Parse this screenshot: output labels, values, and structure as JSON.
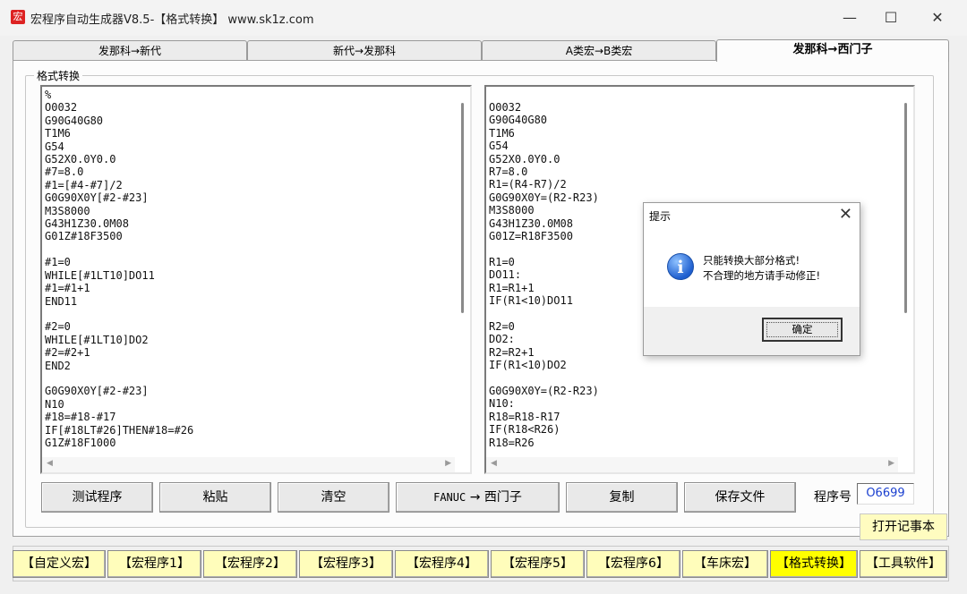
{
  "window": {
    "app_icon": "宏",
    "title": "宏程序自动生成器V8.5-【格式转换】   www.sk1z.com",
    "min": "—",
    "max": "☐",
    "close": "✕"
  },
  "tabs": [
    {
      "label": "发那科→新代"
    },
    {
      "label": "新代→发那科"
    },
    {
      "label": "A类宏→B类宏"
    },
    {
      "label": "发那科→西门子"
    }
  ],
  "group_title": "格式转换",
  "left_code": "%\nO0032\nG90G40G80\nT1M6\nG54\nG52X0.0Y0.0\n#7=8.0\n#1=[#4-#7]/2\nG0G90X0Y[#2-#23]\nM3S8000\nG43H1Z30.0M08\nG01Z#18F3500\n\n#1=0\nWHILE[#1LT10]DO11\n#1=#1+1\nEND11\n\n#2=0\nWHILE[#1LT10]DO2\n#2=#2+1\nEND2\n\nG0G90X0Y[#2-#23]\nN10\n#18=#18-#17\nIF[#18LT#26]THEN#18=#26\nG1Z#18F1000",
  "right_code": "O0032\nG90G40G80\nT1M6\nG54\nG52X0.0Y0.0\nR7=8.0\nR1=(R4-R7)/2\nG0G90X0Y=(R2-R23)\nM3S8000\nG43H1Z30.0M08\nG01Z=R18F3500\n\nR1=0\nDO11:\nR1=R1+1\nIF(R1<10)DO11\n\nR2=0\nDO2:\nR2=R2+1\nIF(R1<10)DO2\n\nG0G90X0Y=(R2-R23)\nN10:\nR18=R18-R17\nIF(R18<R26)\nR18=R26",
  "buttons": {
    "test": "测试程序",
    "paste": "粘贴",
    "clear": "清空",
    "convert_from": "FANUC",
    "convert_arrow": "→",
    "convert_to": "西门子",
    "copy": "复制",
    "save": "保存文件"
  },
  "program_no": {
    "label": "程序号",
    "value": "O6699"
  },
  "notepad": "打开记事本",
  "macro_tabs": [
    {
      "label": "【自定义宏】"
    },
    {
      "label": "【宏程序1】"
    },
    {
      "label": "【宏程序2】"
    },
    {
      "label": "【宏程序3】"
    },
    {
      "label": "【宏程序4】"
    },
    {
      "label": "【宏程序5】"
    },
    {
      "label": "【宏程序6】"
    },
    {
      "label": "【车床宏】"
    },
    {
      "label": "【格式转换】"
    },
    {
      "label": "【工具软件】"
    }
  ],
  "dialog": {
    "title": "提示",
    "close": "✕",
    "icon": "i",
    "line1": "只能转换大部分格式!",
    "line2": "不合理的地方请手动修正!",
    "ok": "确定"
  },
  "icons": {
    "info": "info-icon",
    "scroll_left": "◀",
    "scroll_right": "▶"
  },
  "colors": {
    "macro_tab_bg": "#fffdbb",
    "macro_tab_active": "#ffff00",
    "program_no_text": "#1a3fcf"
  }
}
